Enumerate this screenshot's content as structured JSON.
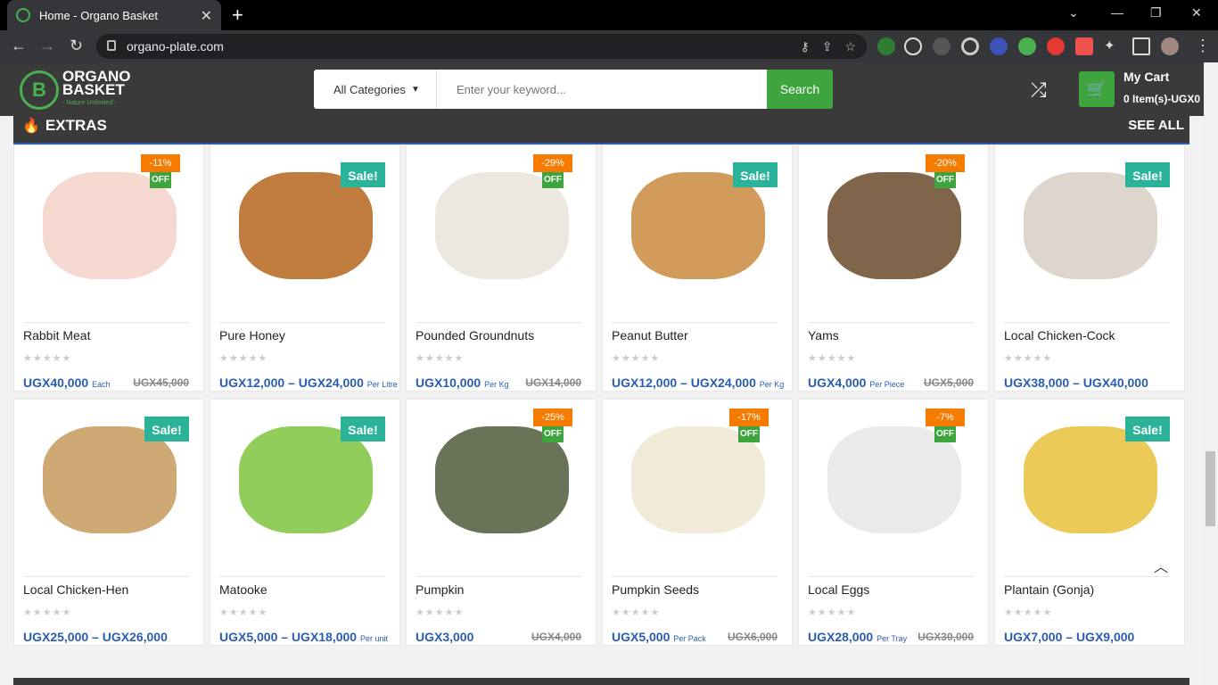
{
  "browser": {
    "tab_title": "Home - Organo Basket",
    "url": "organo-plate.com"
  },
  "site": {
    "logo_line1": "ORGANO",
    "logo_line2": "BASKET",
    "logo_tag": "- Nature Unlimited -",
    "category_label": "All Categories",
    "search_placeholder": "Enter your keyword...",
    "search_button": "Search",
    "cart_title": "My Cart",
    "cart_sub": "0 Item(s)-UGX0"
  },
  "section": {
    "title": "EXTRAS",
    "see_all": "SEE ALL"
  },
  "products": [
    {
      "name": "Rabbit Meat",
      "price": "UGX40,000",
      "unit": "Each",
      "old": "UGX45,000",
      "pct": "-11%",
      "badge": "discount"
    },
    {
      "name": "Pure Honey",
      "price": "UGX12,000 – UGX24,000",
      "unit": "Per Litre",
      "old": "",
      "badge": "sale"
    },
    {
      "name": "Pounded Groundnuts",
      "price": "UGX10,000",
      "unit": "Per Kg",
      "old": "UGX14,000",
      "pct": "-29%",
      "badge": "discount"
    },
    {
      "name": "Peanut Butter",
      "price": "UGX12,000 – UGX24,000",
      "unit": "Per Kg",
      "old": "",
      "badge": "sale"
    },
    {
      "name": "Yams",
      "price": "UGX4,000",
      "unit": "Per Piece",
      "old": "UGX5,000",
      "pct": "-20%",
      "badge": "discount"
    },
    {
      "name": "Local Chicken-Cock",
      "price": "UGX38,000 – UGX40,000",
      "unit": "",
      "old": "",
      "badge": "sale"
    },
    {
      "name": "Local Chicken-Hen",
      "price": "UGX25,000 – UGX26,000",
      "unit": "",
      "old": "",
      "badge": "sale"
    },
    {
      "name": "Matooke",
      "price": "UGX5,000 – UGX18,000",
      "unit": "Per unit",
      "old": "",
      "badge": "sale"
    },
    {
      "name": "Pumpkin",
      "price": "UGX3,000",
      "unit": "",
      "old": "UGX4,000",
      "pct": "-25%",
      "badge": "discount"
    },
    {
      "name": "Pumpkin Seeds",
      "price": "UGX5,000",
      "unit": "Per Pack",
      "old": "UGX6,000",
      "pct": "-17%",
      "badge": "discount"
    },
    {
      "name": "Local Eggs",
      "price": "UGX28,000",
      "unit": "Per Tray",
      "old": "UGX30,000",
      "pct": "-7%",
      "badge": "discount"
    },
    {
      "name": "Plantain (Gonja)",
      "price": "UGX7,000 – UGX9,000",
      "unit": "",
      "old": "",
      "badge": "sale"
    }
  ],
  "labels": {
    "off": "OFF",
    "sale": "Sale!",
    "stars": "★★★★★"
  }
}
